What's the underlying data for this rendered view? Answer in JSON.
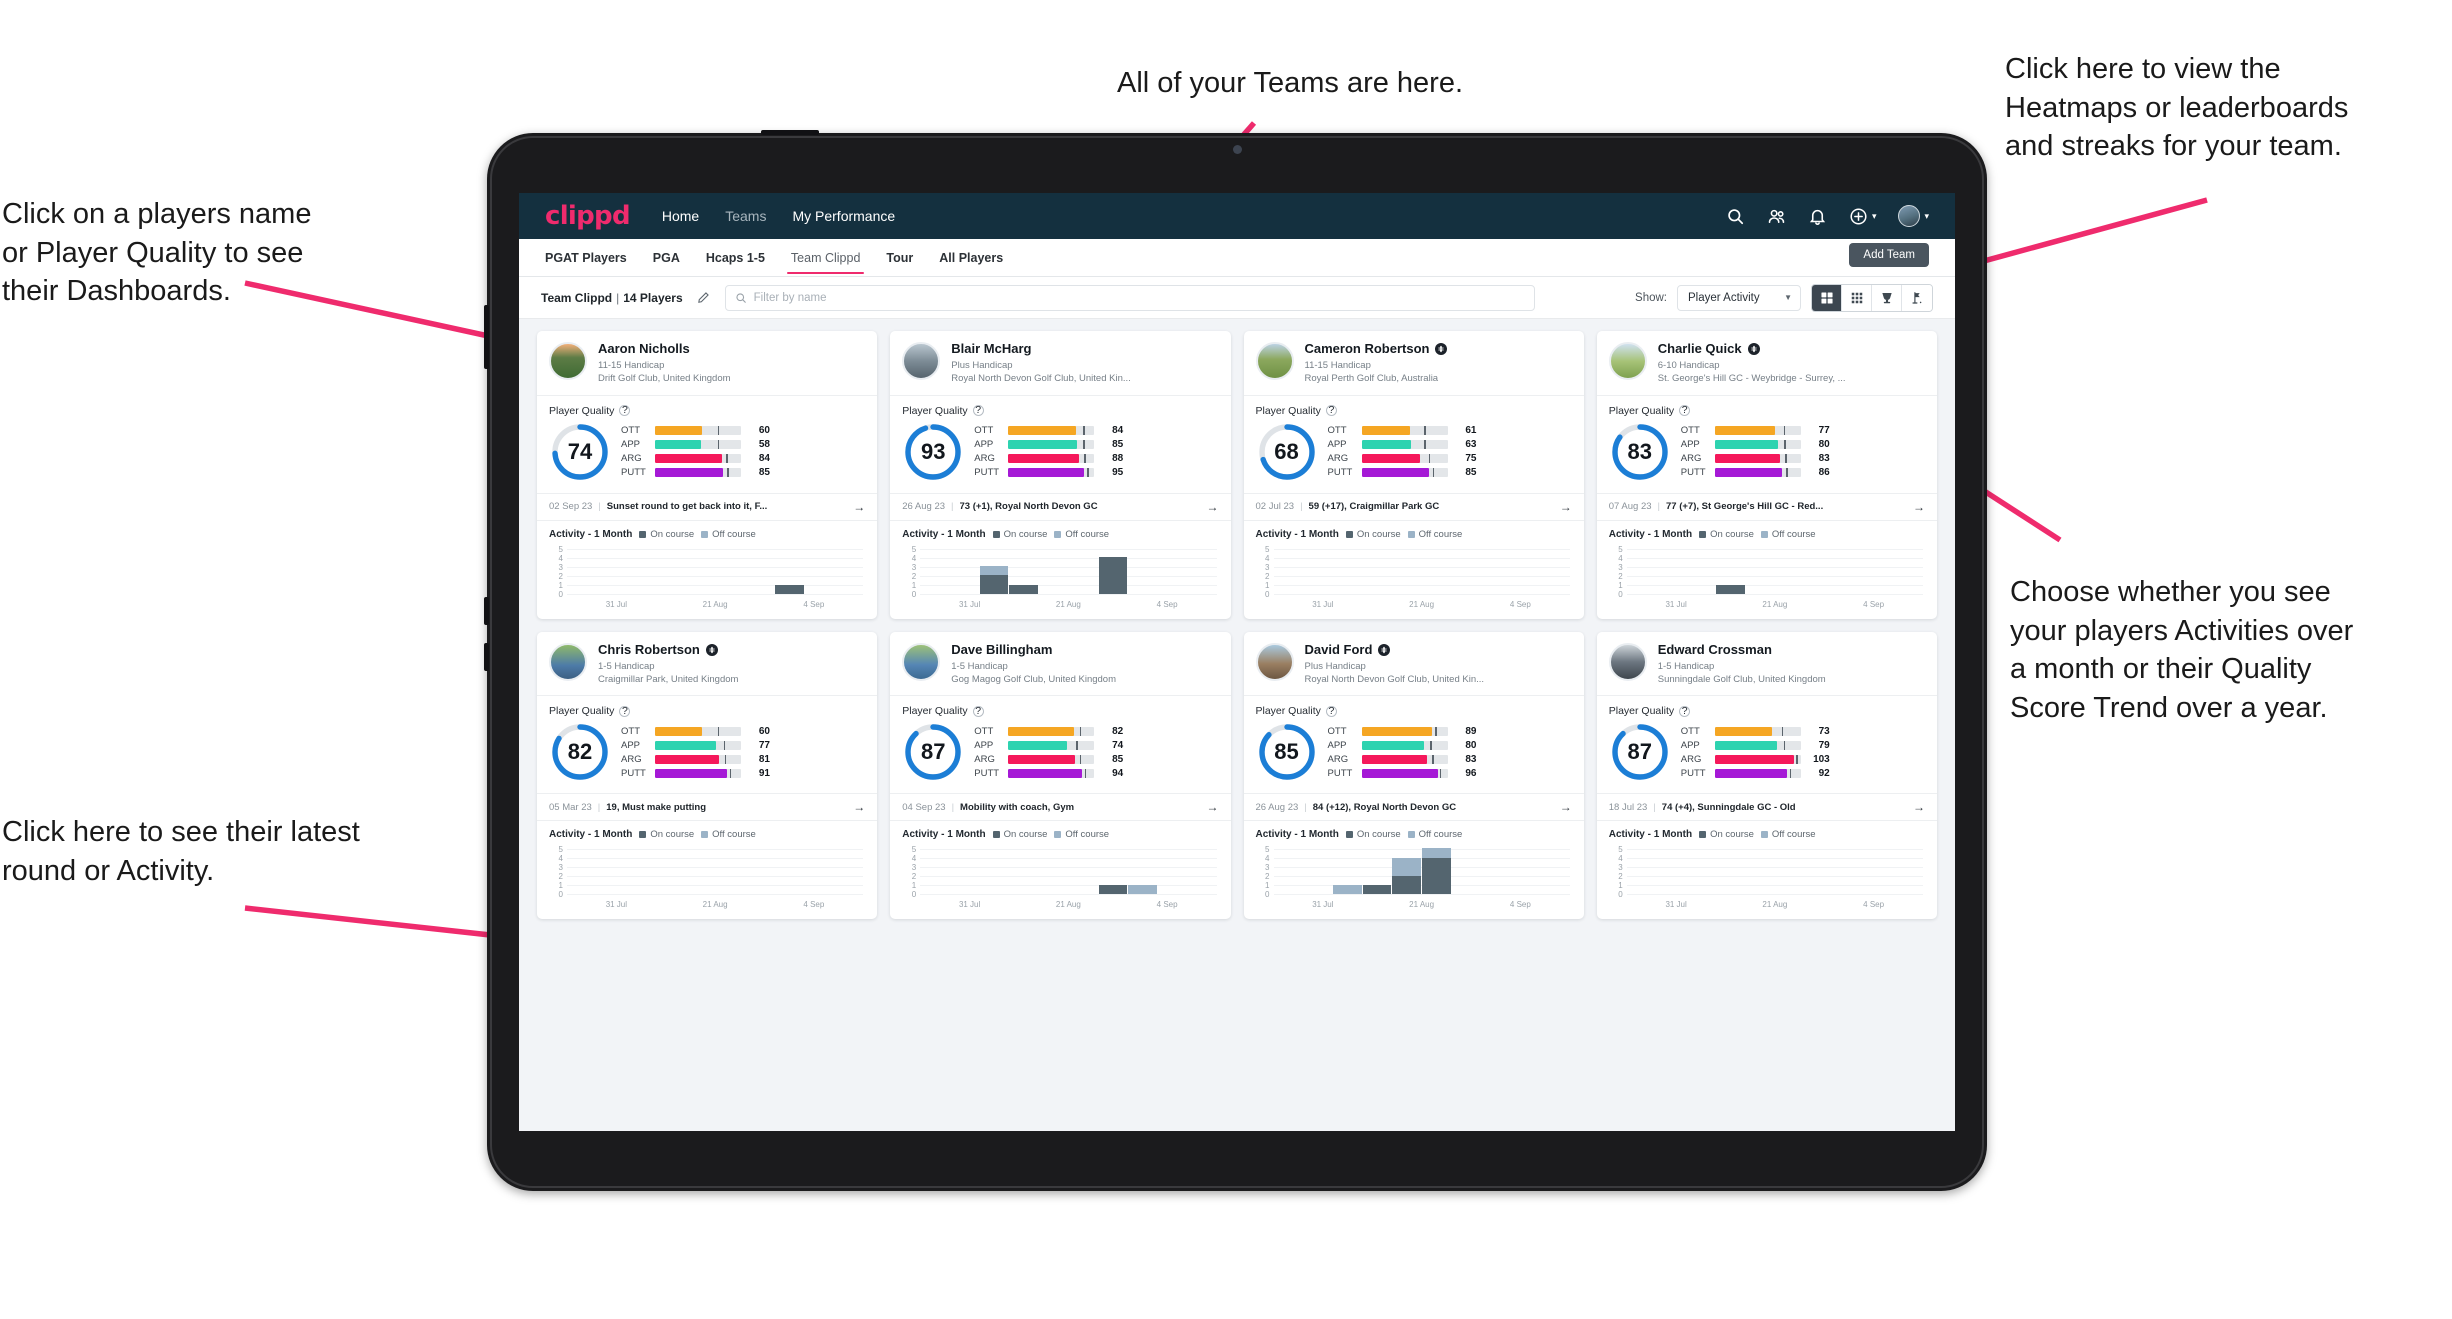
{
  "annotations": [
    {
      "id": "teams",
      "text": "All of your Teams are here."
    },
    {
      "id": "heatmaps",
      "text": "Click here to view the\nHeatmaps or leaderboards\nand streaks for your team."
    },
    {
      "id": "dashboards",
      "text": "Click on a players name\nor Player Quality to see\ntheir Dashboards."
    },
    {
      "id": "activity_choice",
      "text": "Choose whether you see\nyour players Activities over\na month or their Quality\nScore Trend over a year."
    },
    {
      "id": "latest_round",
      "text": "Click here to see their latest\nround or Activity."
    }
  ],
  "app": {
    "brand": "clippd",
    "nav": [
      {
        "label": "Home",
        "active": true
      },
      {
        "label": "Teams",
        "active": false
      },
      {
        "label": "My Performance",
        "active": true
      }
    ],
    "nav_icons": [
      "search-icon",
      "people-icon",
      "bell-icon",
      "plus-circle-icon",
      "avatar"
    ],
    "subtabs": [
      {
        "label": "PGAT Players",
        "active": false
      },
      {
        "label": "PGA",
        "active": false
      },
      {
        "label": "Hcaps 1-5",
        "active": false
      },
      {
        "label": "Team Clippd",
        "active": true
      },
      {
        "label": "Tour",
        "active": false
      },
      {
        "label": "All Players",
        "active": false
      }
    ],
    "add_team_label": "Add Team",
    "toolbar": {
      "team_name": "Team Clippd",
      "team_separator": "|",
      "player_count": "14 Players",
      "edit_icon": "pencil-icon",
      "search_placeholder": "Filter by name",
      "search_value": "",
      "show_label": "Show:",
      "show_value": "Player Activity",
      "view_buttons": [
        {
          "name": "grid-view",
          "icon": "grid-large-icon",
          "active": true
        },
        {
          "name": "heatmap-view",
          "icon": "grid-small-icon",
          "active": false
        },
        {
          "name": "leaderboard-view",
          "icon": "trophy-icon",
          "active": false
        },
        {
          "name": "streaks-view",
          "icon": "golf-flag-icon",
          "active": false
        }
      ]
    },
    "quality_section_label": "Player Quality",
    "activity_section_label": "Activity - 1 Month",
    "legend": [
      {
        "label": "On course",
        "color": "#54656f"
      },
      {
        "label": "Off course",
        "color": "#9bb3c7"
      }
    ],
    "chart_y_ticks": [
      "5",
      "4",
      "3",
      "2",
      "1",
      "0"
    ],
    "chart_x_ticks": [
      "31 Jul",
      "21 Aug",
      "4 Sep"
    ]
  },
  "colors": {
    "brand_pink": "#ef2b6d",
    "navbar": "#14303f",
    "ring": "#1c7ed6",
    "ott": "#f5a623",
    "app": "#2ed3b0",
    "arg": "#f5185b",
    "putt": "#a519d6"
  },
  "metric_labels": [
    "OTT",
    "APP",
    "ARG",
    "PUTT"
  ],
  "players": [
    {
      "name": "Aaron Nicholls",
      "verified": false,
      "avatar": "av-a",
      "handicap": "11-15 Handicap",
      "club": "Drift Golf Club, United Kingdom",
      "quality": 74,
      "ring_pct": 74,
      "metrics": [
        {
          "label": "OTT",
          "value": 60,
          "fill": 55,
          "tick": 73
        },
        {
          "label": "APP",
          "value": 58,
          "fill": 53,
          "tick": 73
        },
        {
          "label": "ARG",
          "value": 84,
          "fill": 78,
          "tick": 83
        },
        {
          "label": "PUTT",
          "value": 85,
          "fill": 79,
          "tick": 84
        }
      ],
      "round": {
        "date": "02 Sep 23",
        "desc": "Sunset round to get back into it, F..."
      },
      "chart": {
        "type": "bar",
        "on": [
          0,
          0,
          0,
          0,
          0,
          0,
          0,
          1,
          0,
          0
        ],
        "off": [
          0,
          0,
          0,
          0,
          0,
          0,
          0,
          0,
          0,
          0
        ]
      }
    },
    {
      "name": "Blair McHarg",
      "verified": false,
      "avatar": "av-b",
      "handicap": "Plus Handicap",
      "club": "Royal North Devon Golf Club, United Kin...",
      "quality": 93,
      "ring_pct": 95,
      "metrics": [
        {
          "label": "OTT",
          "value": 84,
          "fill": 79,
          "tick": 87
        },
        {
          "label": "APP",
          "value": 85,
          "fill": 80,
          "tick": 87
        },
        {
          "label": "ARG",
          "value": 88,
          "fill": 82,
          "tick": 88
        },
        {
          "label": "PUTT",
          "value": 95,
          "fill": 88,
          "tick": 92
        }
      ],
      "round": {
        "date": "26 Aug 23",
        "desc": "73 (+1), Royal North Devon GC"
      },
      "chart": {
        "type": "bar",
        "on": [
          0,
          0,
          2,
          1,
          0,
          0,
          4,
          0,
          0,
          0
        ],
        "off": [
          0,
          0,
          1,
          0,
          0,
          0,
          0,
          0,
          0,
          0
        ]
      }
    },
    {
      "name": "Cameron Robertson",
      "verified": true,
      "avatar": "av-c",
      "handicap": "11-15 Handicap",
      "club": "Royal Perth Golf Club, Australia",
      "quality": 68,
      "ring_pct": 70,
      "metrics": [
        {
          "label": "OTT",
          "value": 61,
          "fill": 56,
          "tick": 73
        },
        {
          "label": "APP",
          "value": 63,
          "fill": 57,
          "tick": 73
        },
        {
          "label": "ARG",
          "value": 75,
          "fill": 68,
          "tick": 78
        },
        {
          "label": "PUTT",
          "value": 85,
          "fill": 79,
          "tick": 83
        }
      ],
      "round": {
        "date": "02 Jul 23",
        "desc": "59 (+17), Craigmillar Park GC"
      },
      "chart": {
        "type": "bar",
        "on": [
          0,
          0,
          0,
          0,
          0,
          0,
          0,
          0,
          0,
          0
        ],
        "off": [
          0,
          0,
          0,
          0,
          0,
          0,
          0,
          0,
          0,
          0
        ]
      }
    },
    {
      "name": "Charlie Quick",
      "verified": true,
      "avatar": "av-d",
      "handicap": "6-10 Handicap",
      "club": "St. George's Hill GC - Weybridge - Surrey, ...",
      "quality": 83,
      "ring_pct": 85,
      "metrics": [
        {
          "label": "OTT",
          "value": 77,
          "fill": 70,
          "tick": 80
        },
        {
          "label": "APP",
          "value": 80,
          "fill": 73,
          "tick": 81
        },
        {
          "label": "ARG",
          "value": 83,
          "fill": 76,
          "tick": 82
        },
        {
          "label": "PUTT",
          "value": 86,
          "fill": 78,
          "tick": 83
        }
      ],
      "round": {
        "date": "07 Aug 23",
        "desc": "77 (+7), St George's Hill GC - Red..."
      },
      "chart": {
        "type": "bar",
        "on": [
          0,
          0,
          0,
          1,
          0,
          0,
          0,
          0,
          0,
          0
        ],
        "off": [
          0,
          0,
          0,
          0,
          0,
          0,
          0,
          0,
          0,
          0
        ]
      }
    },
    {
      "name": "Chris Robertson",
      "verified": true,
      "avatar": "av-e",
      "handicap": "1-5 Handicap",
      "club": "Craigmillar Park, United Kingdom",
      "quality": 82,
      "ring_pct": 84,
      "metrics": [
        {
          "label": "OTT",
          "value": 60,
          "fill": 55,
          "tick": 73
        },
        {
          "label": "APP",
          "value": 77,
          "fill": 71,
          "tick": 80
        },
        {
          "label": "ARG",
          "value": 81,
          "fill": 74,
          "tick": 81
        },
        {
          "label": "PUTT",
          "value": 91,
          "fill": 84,
          "tick": 87
        }
      ],
      "round": {
        "date": "05 Mar 23",
        "desc": "19, Must make putting"
      },
      "chart": {
        "type": "bar",
        "on": [
          0,
          0,
          0,
          0,
          0,
          0,
          0,
          0,
          0,
          0
        ],
        "off": [
          0,
          0,
          0,
          0,
          0,
          0,
          0,
          0,
          0,
          0
        ]
      }
    },
    {
      "name": "Dave Billingham",
      "verified": false,
      "avatar": "av-f",
      "handicap": "1-5 Handicap",
      "club": "Gog Magog Golf Club, United Kingdom",
      "quality": 87,
      "ring_pct": 88,
      "metrics": [
        {
          "label": "OTT",
          "value": 82,
          "fill": 76,
          "tick": 83
        },
        {
          "label": "APP",
          "value": 74,
          "fill": 68,
          "tick": 79
        },
        {
          "label": "ARG",
          "value": 85,
          "fill": 78,
          "tick": 83
        },
        {
          "label": "PUTT",
          "value": 94,
          "fill": 86,
          "tick": 89
        }
      ],
      "round": {
        "date": "04 Sep 23",
        "desc": "Mobility with coach, Gym"
      },
      "chart": {
        "type": "bar",
        "on": [
          0,
          0,
          0,
          0,
          0,
          0,
          1,
          0,
          0,
          0
        ],
        "off": [
          0,
          0,
          0,
          0,
          0,
          0,
          0,
          1,
          0,
          0
        ]
      }
    },
    {
      "name": "David Ford",
      "verified": true,
      "avatar": "av-g",
      "handicap": "Plus Handicap",
      "club": "Royal North Devon Golf Club, United Kin...",
      "quality": 85,
      "ring_pct": 87,
      "metrics": [
        {
          "label": "OTT",
          "value": 89,
          "fill": 82,
          "tick": 86
        },
        {
          "label": "APP",
          "value": 80,
          "fill": 73,
          "tick": 80
        },
        {
          "label": "ARG",
          "value": 83,
          "fill": 76,
          "tick": 82
        },
        {
          "label": "PUTT",
          "value": 96,
          "fill": 89,
          "tick": 91
        }
      ],
      "round": {
        "date": "26 Aug 23",
        "desc": "84 (+12), Royal North Devon GC"
      },
      "chart": {
        "type": "bar",
        "on": [
          0,
          0,
          0,
          1,
          2,
          4,
          0,
          0,
          0,
          0
        ],
        "off": [
          0,
          0,
          1,
          0,
          2,
          1,
          0,
          0,
          0,
          0
        ]
      }
    },
    {
      "name": "Edward Crossman",
      "verified": false,
      "avatar": "av-h",
      "handicap": "1-5 Handicap",
      "club": "Sunningdale Golf Club, United Kingdom",
      "quality": 87,
      "ring_pct": 88,
      "metrics": [
        {
          "label": "OTT",
          "value": 73,
          "fill": 67,
          "tick": 78
        },
        {
          "label": "APP",
          "value": 79,
          "fill": 72,
          "tick": 80
        },
        {
          "label": "ARG",
          "value": 103,
          "fill": 92,
          "tick": 95
        },
        {
          "label": "PUTT",
          "value": 92,
          "fill": 84,
          "tick": 87
        }
      ],
      "round": {
        "date": "18 Jul 23",
        "desc": "74 (+4), Sunningdale GC - Old"
      },
      "chart": {
        "type": "bar",
        "on": [
          0,
          0,
          0,
          0,
          0,
          0,
          0,
          0,
          0,
          0
        ],
        "off": [
          0,
          0,
          0,
          0,
          0,
          0,
          0,
          0,
          0,
          0
        ]
      }
    }
  ]
}
